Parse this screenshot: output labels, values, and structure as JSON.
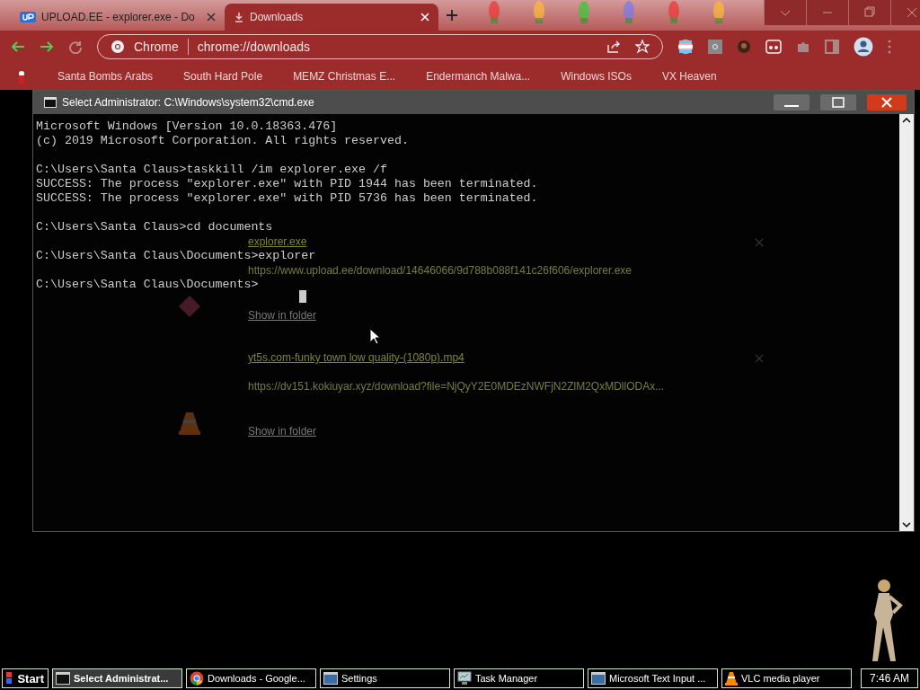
{
  "browser": {
    "tabs": [
      {
        "title": "UPLOAD.EE - explorer.exe - Do",
        "selected": false,
        "kind": "upload"
      },
      {
        "title": "Downloads",
        "selected": true,
        "kind": "download"
      }
    ],
    "omnibox": {
      "chip": "Chrome",
      "url": "chrome://downloads"
    },
    "bookmarks": [
      "Santa Bombs Arabs",
      "South Hard Pole",
      "MEMZ Christmas E...",
      "Endermanch Malwa...",
      "Windows ISOs",
      "VX Heaven"
    ]
  },
  "downloads": [
    {
      "name": "explorer.exe",
      "url": "https://www.upload.ee/download/14646066/9d788b088f141c26f606/explorer.exe",
      "action": "Show in folder",
      "kind": "exe"
    },
    {
      "name": "yt5s.com-funky town low quality-(1080p).mp4",
      "url": "https://dv151.kokiuyar.xyz/download?file=NjQyY2E0MDEzNWFjN2ZlM2QxMDllODAx...",
      "action": "Show in folder",
      "kind": "video"
    }
  ],
  "console": {
    "title": "Select Administrator: C:\\Windows\\system32\\cmd.exe",
    "blocks": [
      [
        "Microsoft Windows [Version 10.0.18363.476]",
        "(c) 2019 Microsoft Corporation. All rights reserved."
      ],
      [
        "C:\\Users\\Santa Claus>taskkill /im explorer.exe /f",
        "SUCCESS: The process \"explorer.exe\" with PID 1944 has been terminated.",
        "SUCCESS: The process \"explorer.exe\" with PID 5736 has been terminated."
      ],
      [
        "C:\\Users\\Santa Claus>cd documents"
      ],
      [
        "C:\\Users\\Santa Claus\\Documents>explorer"
      ],
      [
        "C:\\Users\\Santa Claus\\Documents>"
      ]
    ]
  },
  "taskbar": {
    "start": "Start",
    "items": [
      {
        "label": "Select Administrat...",
        "selected": true,
        "kind": "console"
      },
      {
        "label": "Downloads - Google...",
        "selected": false,
        "kind": "chrome"
      },
      {
        "label": "Settings",
        "selected": false,
        "kind": "window"
      },
      {
        "label": "Task Manager",
        "selected": false,
        "kind": "monitor"
      },
      {
        "label": "Microsoft Text Input ...",
        "selected": false,
        "kind": "window"
      },
      {
        "label": "VLC media player",
        "selected": false,
        "kind": "vlc"
      }
    ],
    "clock": "7:46 AM"
  }
}
